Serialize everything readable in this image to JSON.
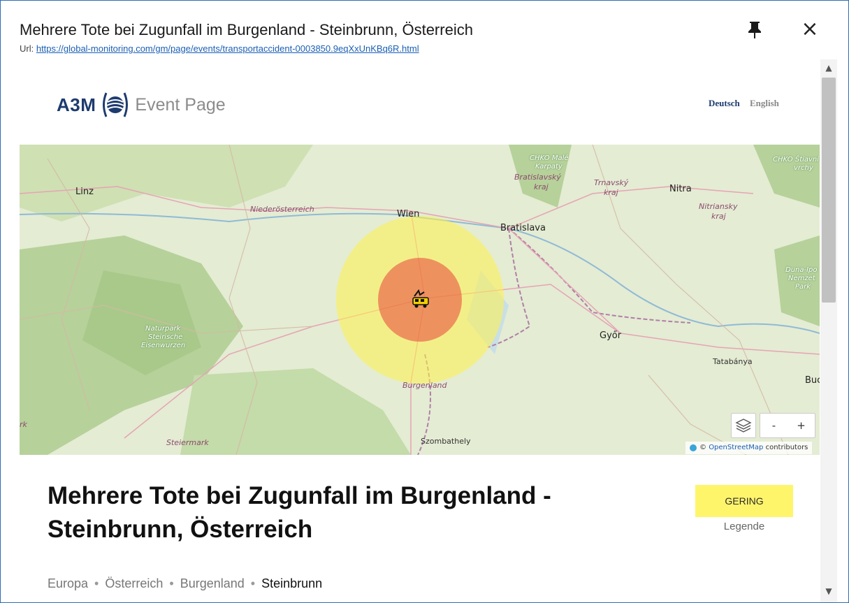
{
  "dialog": {
    "title": "Mehrere Tote bei Zugunfall im Burgenland - Steinbrunn, Österreich",
    "url_label": "Url:",
    "url": "https://global-monitoring.com/gm/page/events/transportaccident-0003850.9eqXxUnKBq6R.html",
    "pin_icon": "pin-icon",
    "close_icon": "close-icon",
    "close_glyph": "×"
  },
  "page": {
    "brand": "A3M",
    "brand_sub": "Event Page",
    "languages": [
      "Deutsch",
      "English"
    ],
    "active_language": "Deutsch"
  },
  "map": {
    "labels": {
      "linz": "Linz",
      "niederoesterreich": "Niederösterreich",
      "wien": "Wien",
      "bratislava": "Bratislava",
      "chko_male_1": "CHKO Malé",
      "chko_male_2": "Karpaty",
      "bratislavsky_1": "Bratislavský",
      "bratislavsky_2": "kraj",
      "trnavsky_1": "Trnavský",
      "trnavsky_2": "kraj",
      "nitra": "Nitra",
      "nitriansky_1": "Nitriansky",
      "nitriansky_2": "kraj",
      "chko_stiav_1": "CHKO Štiavni",
      "chko_stiav_2": "vrchy",
      "duna_1": "Duna-Ipo",
      "duna_2": "Nemzet",
      "duna_3": "Park",
      "naturpark_1": "Naturpark",
      "naturpark_2": "Steirische",
      "naturpark_3": "Eisenwurzen",
      "gyor": "Győr",
      "tatabanya": "Tatabánya",
      "bud": "Buc",
      "burgenland": "Burgenland",
      "steiermark": "Steiermark",
      "szombathely": "Szombathely",
      "rk": "rk"
    },
    "zoom_out": "-",
    "zoom_in": "+",
    "layers_icon": "layers-icon",
    "attribution_prefix": "©",
    "attribution_link": "OpenStreetMap",
    "attribution_suffix": "contributors",
    "marker_icon": "train-accident-icon",
    "zone_outer_color": "#fff24a",
    "zone_inner_color": "#e8463c"
  },
  "event": {
    "title": "Mehrere Tote bei Zugunfall im Burgenland - Steinbrunn, Österreich",
    "severity": "GERING",
    "severity_color": "#fff56b",
    "legend": "Legende",
    "breadcrumb": [
      "Europa",
      "Österreich",
      "Burgenland",
      "Steinbrunn"
    ]
  },
  "scrollbar": {
    "up_icon": "scroll-up-icon",
    "down_icon": "scroll-down-icon"
  }
}
